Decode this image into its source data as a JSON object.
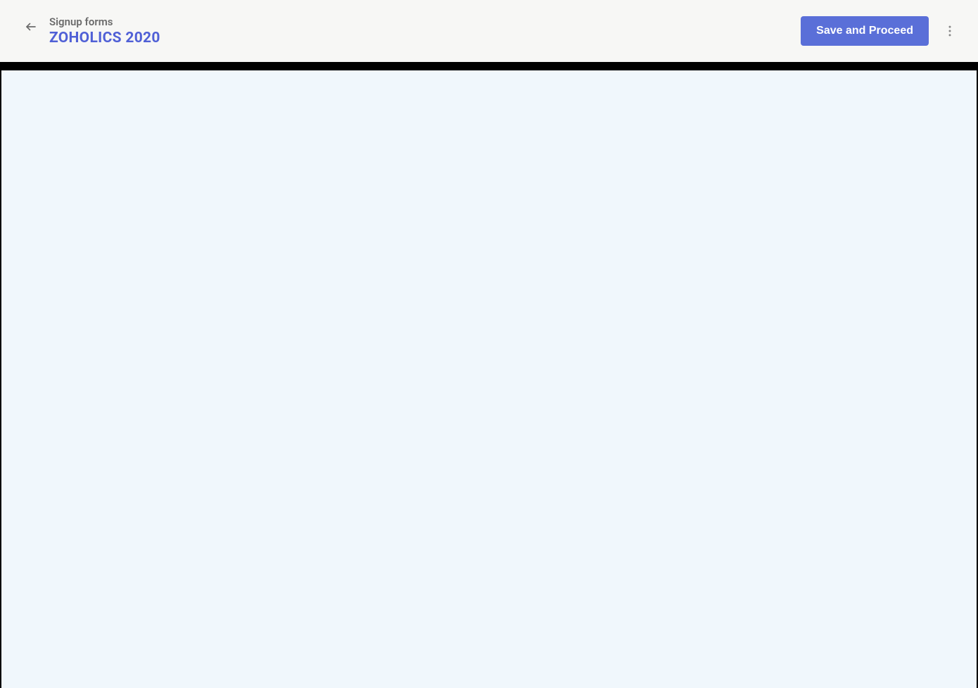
{
  "header": {
    "breadcrumb": "Signup forms",
    "title": "ZOHOLICS 2020",
    "save_button_label": "Save and Proceed"
  }
}
